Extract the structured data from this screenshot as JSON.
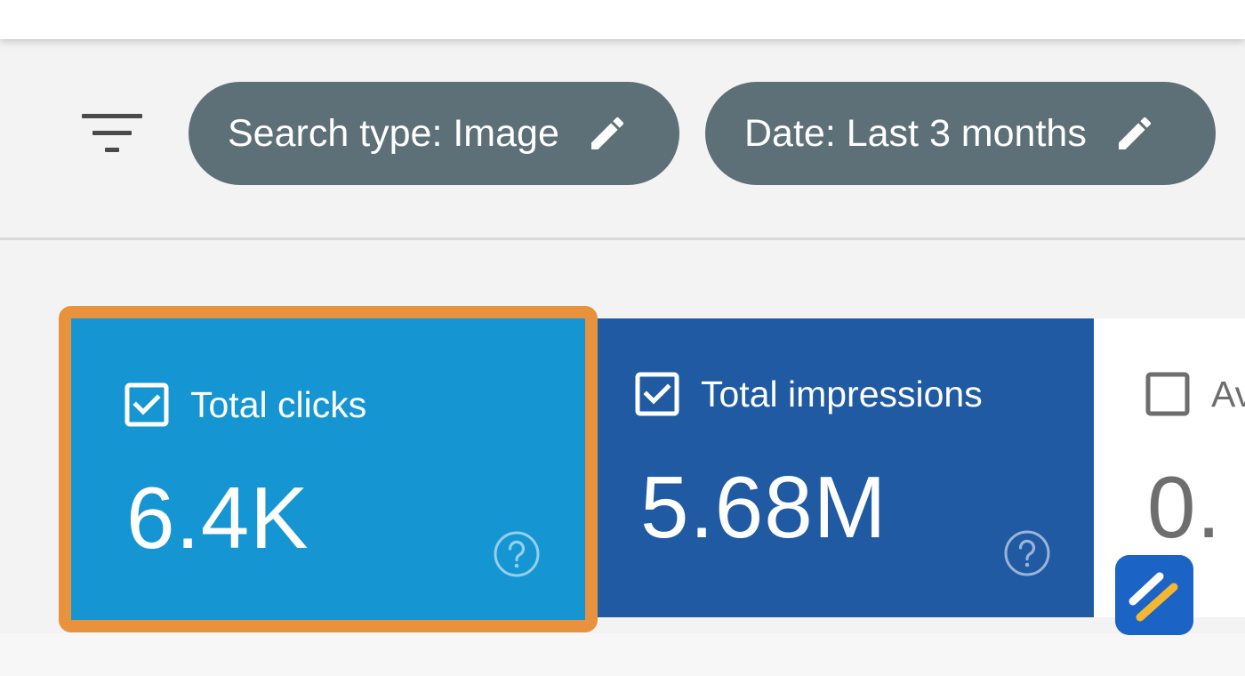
{
  "filters": {
    "chips": [
      {
        "label": "Search type: Image",
        "edit_icon": "pencil-icon"
      },
      {
        "label": "Date: Last 3 months",
        "edit_icon": "pencil-icon"
      }
    ],
    "filter_icon": "filter-lines-icon"
  },
  "metrics": {
    "cards": [
      {
        "label": "Total clicks",
        "value": "6.4K",
        "checked": true,
        "highlighted": true,
        "color": "#1596d3"
      },
      {
        "label": "Total impressions",
        "value": "5.68M",
        "checked": true,
        "color": "#1f5aa3"
      },
      {
        "label": "Av",
        "value": "0.",
        "checked": false,
        "color": "#ffffff"
      }
    ],
    "help_icon": "help-circle-icon"
  },
  "colors": {
    "chip_bg": "#5d6f77",
    "highlight_border": "#e8923e",
    "logo_bg": "#1b63c4",
    "logo_stripe": "#f5b731"
  }
}
